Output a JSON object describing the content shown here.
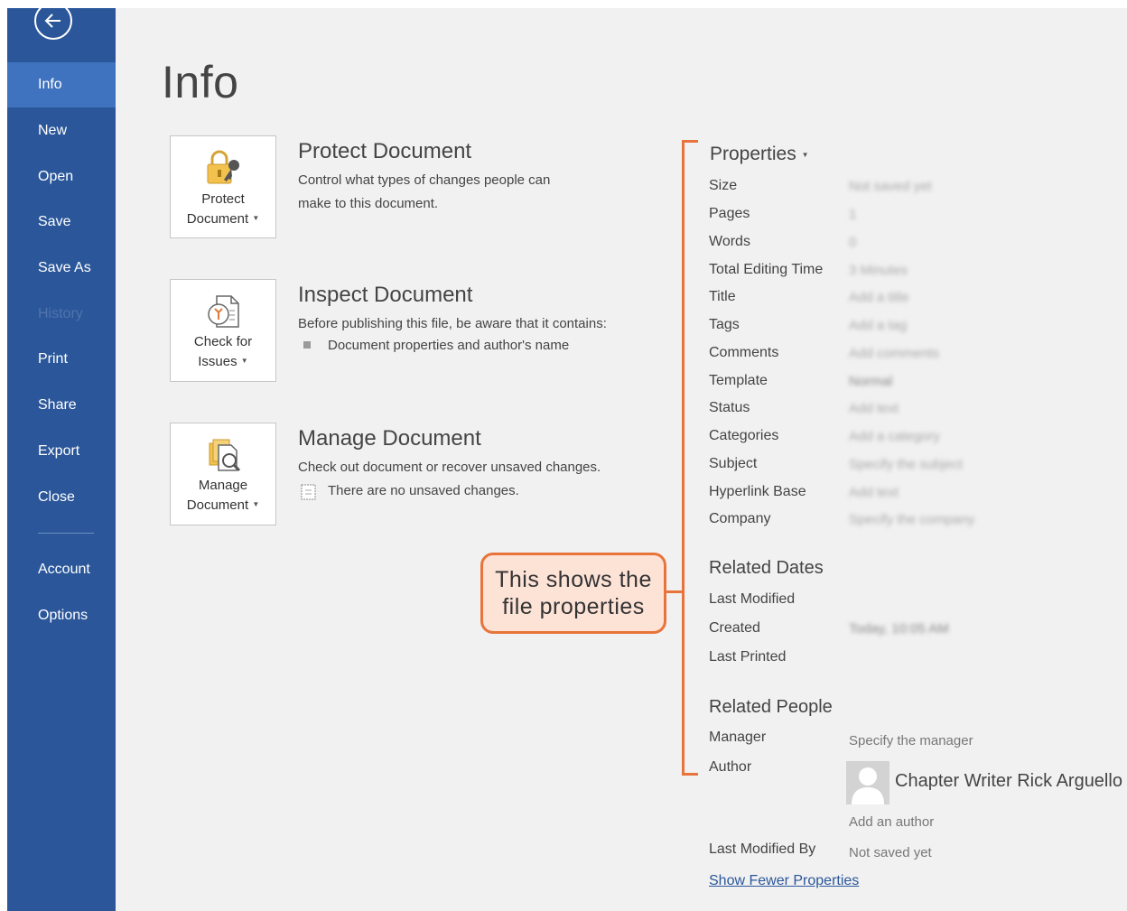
{
  "sidebar": {
    "items": [
      {
        "label": "Info",
        "active": true
      },
      {
        "label": "New"
      },
      {
        "label": "Open"
      },
      {
        "label": "Save"
      },
      {
        "label": "Save As"
      },
      {
        "label": "History",
        "disabled": true
      },
      {
        "label": "Print"
      },
      {
        "label": "Share"
      },
      {
        "label": "Export"
      },
      {
        "label": "Close"
      },
      {
        "label": "Account"
      },
      {
        "label": "Options"
      }
    ]
  },
  "page": {
    "title": "Info"
  },
  "sections": {
    "protect": {
      "button_line1": "Protect",
      "button_line2": "Document",
      "title": "Protect Document",
      "desc_line1": "Control what types of changes people can",
      "desc_line2": "make to this document."
    },
    "inspect": {
      "button_line1": "Check for",
      "button_line2": "Issues",
      "title": "Inspect Document",
      "desc": "Before publishing this file, be aware that it contains:",
      "bullet": "Document properties and author's name"
    },
    "manage": {
      "button_line1": "Manage",
      "button_line2": "Document",
      "title": "Manage Document",
      "desc": "Check out document or recover unsaved changes.",
      "status": "There are no unsaved changes."
    }
  },
  "callout": {
    "line1": "This shows the",
    "line2": "file properties"
  },
  "properties": {
    "title": "Properties",
    "rows": [
      {
        "label": "Size",
        "value": "Not saved yet"
      },
      {
        "label": "Pages",
        "value": "1"
      },
      {
        "label": "Words",
        "value": "0"
      },
      {
        "label": "Total Editing Time",
        "value": "3 Minutes"
      },
      {
        "label": "Title",
        "value": "Add a title"
      },
      {
        "label": "Tags",
        "value": "Add a tag"
      },
      {
        "label": "Comments",
        "value": "Add comments"
      },
      {
        "label": "Template",
        "value": "Normal"
      },
      {
        "label": "Status",
        "value": "Add text"
      },
      {
        "label": "Categories",
        "value": "Add a category"
      },
      {
        "label": "Subject",
        "value": "Specify the subject"
      },
      {
        "label": "Hyperlink Base",
        "value": "Add text"
      },
      {
        "label": "Company",
        "value": "Specify the company"
      }
    ]
  },
  "related_dates": {
    "title": "Related Dates",
    "last_modified_label": "Last Modified",
    "created_label": "Created",
    "created_value": "Today, 10:05 AM",
    "last_printed_label": "Last Printed"
  },
  "related_people": {
    "title": "Related People",
    "manager_label": "Manager",
    "manager_value": "Specify the manager",
    "author_label": "Author",
    "author_name": "Chapter Writer Rick Arguello",
    "add_author": "Add an author",
    "last_modified_by_label": "Last Modified By",
    "last_modified_by_value": "Not saved yet"
  },
  "footer": {
    "show_fewer": "Show Fewer Properties"
  },
  "colors": {
    "sidebar": "#2b579a",
    "active": "#3f73bf",
    "accent": "#e8743b",
    "callout_fill": "#fde2d6"
  }
}
